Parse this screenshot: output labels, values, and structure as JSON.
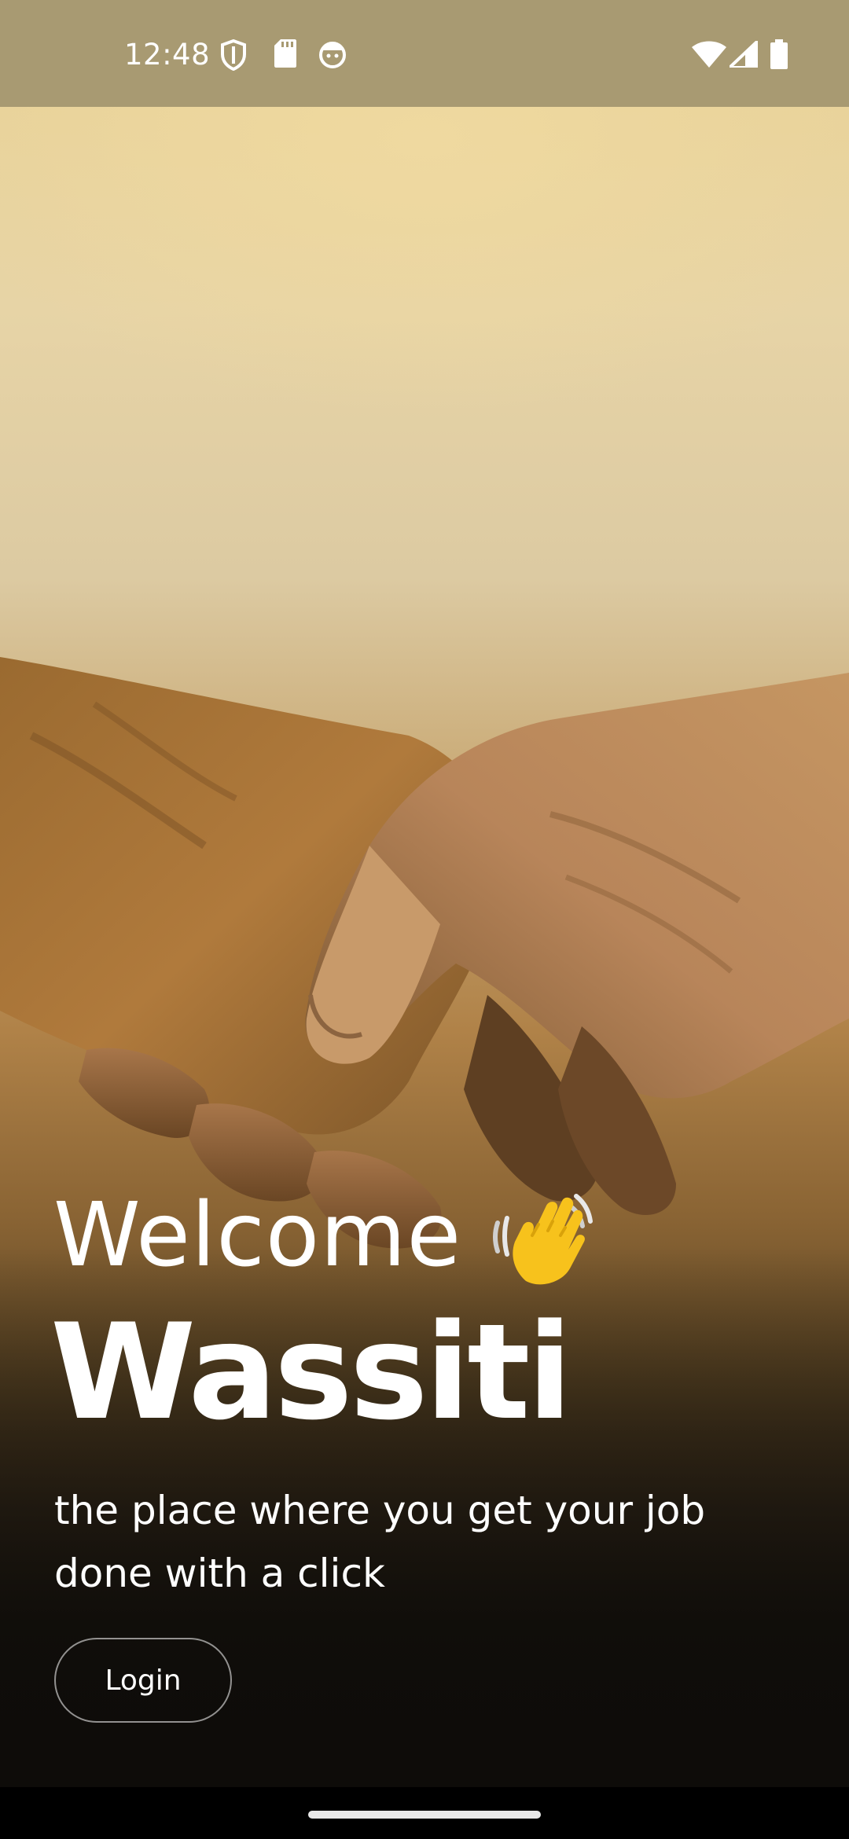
{
  "status_bar": {
    "time": "12:48",
    "icons": [
      "shield-icon",
      "sd-card-icon",
      "face-icon",
      "wifi-icon",
      "signal-icon",
      "battery-icon"
    ]
  },
  "hero": {
    "image": "handshake-photo"
  },
  "welcome": {
    "greeting": "Welcome",
    "emoji_icon": "waving-hand-icon",
    "brand": "Wassiti",
    "tagline": "the place where you get your job done with a click"
  },
  "actions": {
    "login_label": "Login"
  },
  "colors": {
    "status_bar_bg": "#a89a72",
    "text": "#ffffff",
    "bottom_bg": "#0f0d0a",
    "emoji_yellow": "#f7c21c"
  }
}
